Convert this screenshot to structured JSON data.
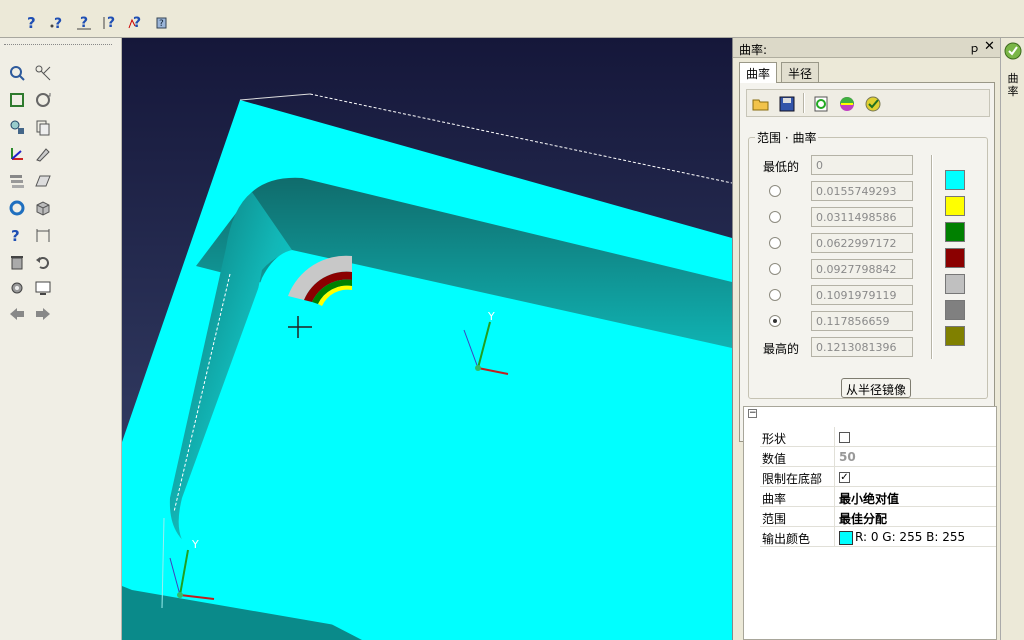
{
  "toolbar": {
    "icons": [
      "help-icon",
      "measure-icon",
      "snap-icon",
      "point-icon",
      "curvature-analysis-icon",
      "model-icon"
    ]
  },
  "left_toolbar": {
    "icons": [
      "zoom-icon",
      "trim-icon",
      "box-select-icon",
      "rotate-view-icon",
      "find-icon",
      "copy-icon",
      "axis-icon",
      "edit-icon",
      "layer-icon",
      "surface-icon",
      "refresh-icon",
      "solid-icon",
      "query-icon",
      "dimension-icon",
      "delete-icon",
      "undo-icon",
      "settings-icon",
      "display-icon",
      "back-arrow-icon",
      "forward-arrow-icon"
    ]
  },
  "panel": {
    "title": "曲率:",
    "pin": "ｐ",
    "close": "✕",
    "tabs": [
      {
        "label": "曲率",
        "active": true
      },
      {
        "label": "半径",
        "active": false
      }
    ],
    "group_label": "范围 · 曲率",
    "min_label": "最低的",
    "max_label": "最高的",
    "values": [
      {
        "value": "0",
        "radio": false,
        "selected": false
      },
      {
        "value": "0.0155749293",
        "radio": true,
        "selected": false
      },
      {
        "value": "0.0311498586",
        "radio": true,
        "selected": false
      },
      {
        "value": "0.0622997172",
        "radio": true,
        "selected": false
      },
      {
        "value": "0.0927798842",
        "radio": true,
        "selected": false
      },
      {
        "value": "0.1091979119",
        "radio": true,
        "selected": false
      },
      {
        "value": "0.117856659",
        "radio": true,
        "selected": true
      },
      {
        "value": "0.1213081396",
        "radio": false,
        "selected": false
      }
    ],
    "swatches": [
      "#00ffff",
      "#ffff00",
      "#008000",
      "#8b0000",
      "#c0c0c0",
      "#808080",
      "#808000"
    ],
    "mirror_button": "从半径镜像",
    "props_collapse": "−",
    "props": [
      {
        "key": "形状",
        "value": "",
        "type": "checkbox",
        "checked": false
      },
      {
        "key": "数值",
        "value": "50",
        "type": "grey"
      },
      {
        "key": "限制在底部",
        "value": "",
        "type": "checkbox",
        "checked": true
      },
      {
        "key": "曲率",
        "value": "最小绝对值",
        "type": "bold"
      },
      {
        "key": "范围",
        "value": "最佳分配",
        "type": "bold"
      },
      {
        "key": "输出颜色",
        "value": "R: 0 G: 255 B: 255",
        "type": "color",
        "color": "#00ffff"
      }
    ]
  },
  "right_strip": {
    "label": "曲率"
  },
  "viewport": {
    "axis_y_label": "Y",
    "axis_y_label_2": "Y"
  }
}
